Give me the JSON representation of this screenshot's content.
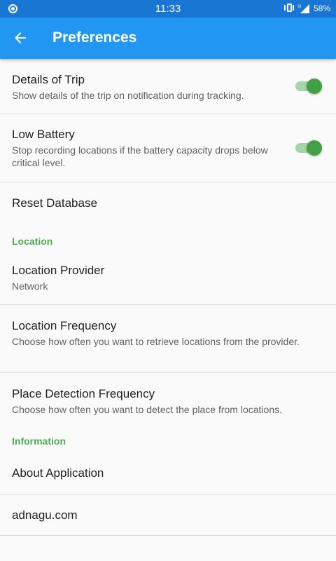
{
  "status_bar": {
    "time": "11:33",
    "battery": "58%",
    "left_icon": "record-circle-icon",
    "right_icons": [
      "vibrate-icon",
      "signal-h-icon"
    ]
  },
  "app_bar": {
    "title": "Preferences",
    "back_icon": "arrow-left-icon"
  },
  "colors": {
    "app_bar": "#2196f3",
    "status_bar": "#1976d2",
    "section_header": "#4caf50",
    "toggle_on": "#43a047"
  },
  "items": {
    "details_of_trip": {
      "title": "Details of Trip",
      "summary": "Show details of the trip on notification during tracking.",
      "enabled": true
    },
    "low_battery": {
      "title": "Low Battery",
      "summary": "Stop recording locations if the battery capacity drops below critical level.",
      "enabled": true
    },
    "reset_database": {
      "title": "Reset Database"
    },
    "location_header": "Location",
    "location_provider": {
      "title": "Location Provider",
      "summary": "Network"
    },
    "location_frequency": {
      "title": "Location Frequency",
      "summary": "Choose how often you want to retrieve locations from the provider."
    },
    "place_detection_frequency": {
      "title": "Place Detection Frequency",
      "summary": "Choose how often you want to detect the place from locations."
    },
    "information_header": "Information",
    "about_application": {
      "title": "About Application"
    },
    "website": {
      "title": "adnagu.com"
    }
  }
}
